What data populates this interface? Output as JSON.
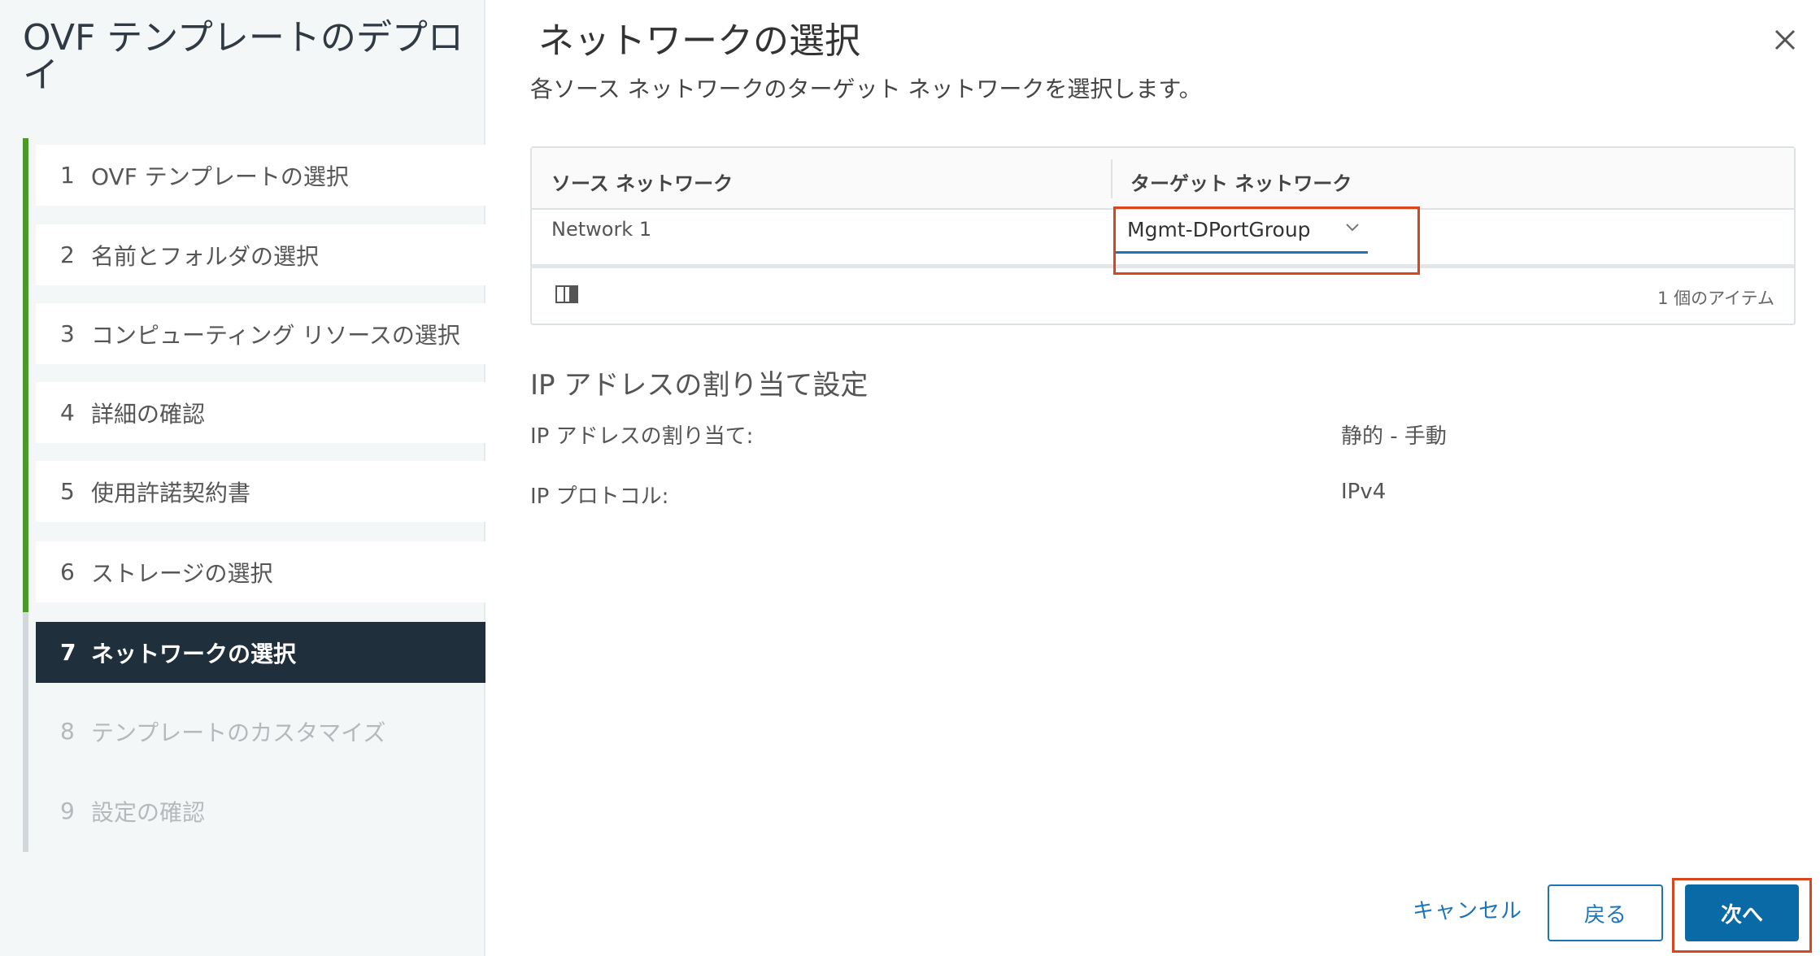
{
  "sidebar": {
    "title": "OVF テンプレートのデプロイ",
    "steps": [
      {
        "num": "1",
        "label": "OVF テンプレートの選択",
        "state": "done"
      },
      {
        "num": "2",
        "label": "名前とフォルダの選択",
        "state": "done"
      },
      {
        "num": "3",
        "label": "コンピューティング リソースの選択",
        "state": "done"
      },
      {
        "num": "4",
        "label": "詳細の確認",
        "state": "done"
      },
      {
        "num": "5",
        "label": "使用許諾契約書",
        "state": "done"
      },
      {
        "num": "6",
        "label": "ストレージの選択",
        "state": "done"
      },
      {
        "num": "7",
        "label": "ネットワークの選択",
        "state": "active"
      },
      {
        "num": "8",
        "label": "テンプレートのカスタマイズ",
        "state": "future"
      },
      {
        "num": "9",
        "label": "設定の確認",
        "state": "future"
      }
    ]
  },
  "main": {
    "title": "ネットワークの選択",
    "subtitle": "各ソース ネットワークのターゲット ネットワークを選択します。",
    "close_icon": "close-icon",
    "table": {
      "columns": [
        "ソース ネットワーク",
        "ターゲット ネットワーク"
      ],
      "rows": [
        {
          "source": "Network 1",
          "target": "Mgmt-DPortGroup"
        }
      ],
      "item_count": "1 個のアイテム"
    },
    "ip_section": {
      "title": "IP アドレスの割り当て設定",
      "allocation_label": "IP アドレスの割り当て:",
      "allocation_value": "静的 - 手動",
      "protocol_label": "IP プロトコル:",
      "protocol_value": "IPv4"
    }
  },
  "footer": {
    "cancel_label": "キャンセル",
    "back_label": "戻る",
    "next_label": "次へ"
  },
  "colors": {
    "accent": "#0a6aa6",
    "step_done": "#4a9a2a",
    "active_step_bg": "#1f2f3b",
    "highlight": "#d9451c"
  }
}
